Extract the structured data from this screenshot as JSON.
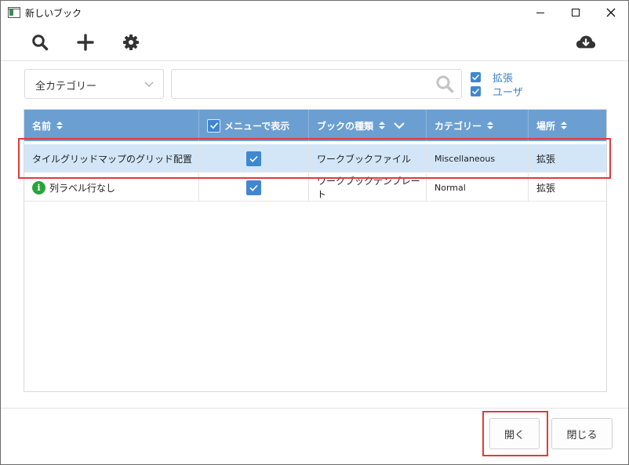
{
  "window": {
    "title": "新しいブック"
  },
  "toolbar": {
    "icons": [
      "search-icon",
      "plus-icon",
      "gear-icon",
      "cloud-download-icon"
    ]
  },
  "filter": {
    "category_selected": "全カテゴリー",
    "search_value": "",
    "checkboxes": [
      {
        "label": "拡張",
        "checked": true
      },
      {
        "label": "ユーザ",
        "checked": true
      }
    ]
  },
  "table": {
    "headers": [
      "名前",
      "メニューで表示",
      "ブックの種類",
      "カテゴリー",
      "場所"
    ],
    "rows": [
      {
        "name": "タイルグリッドマップのグリッド配置",
        "show_in_menu": true,
        "type": "ワークブックファイル",
        "category": "Miscellaneous",
        "location": "拡張",
        "selected": true,
        "info": false
      },
      {
        "name": "列ラベル行なし",
        "show_in_menu": true,
        "type": "ワークブックテンプレート",
        "category": "Normal",
        "location": "拡張",
        "selected": false,
        "info": true
      }
    ]
  },
  "footer": {
    "open_label": "開く",
    "close_label": "閉じる"
  },
  "colors": {
    "header_bg": "#6b9fd1",
    "selected_row": "#d3e6f8",
    "checkbox": "#3f87d0",
    "highlight": "#e03b3b",
    "info": "#2aa33a"
  }
}
